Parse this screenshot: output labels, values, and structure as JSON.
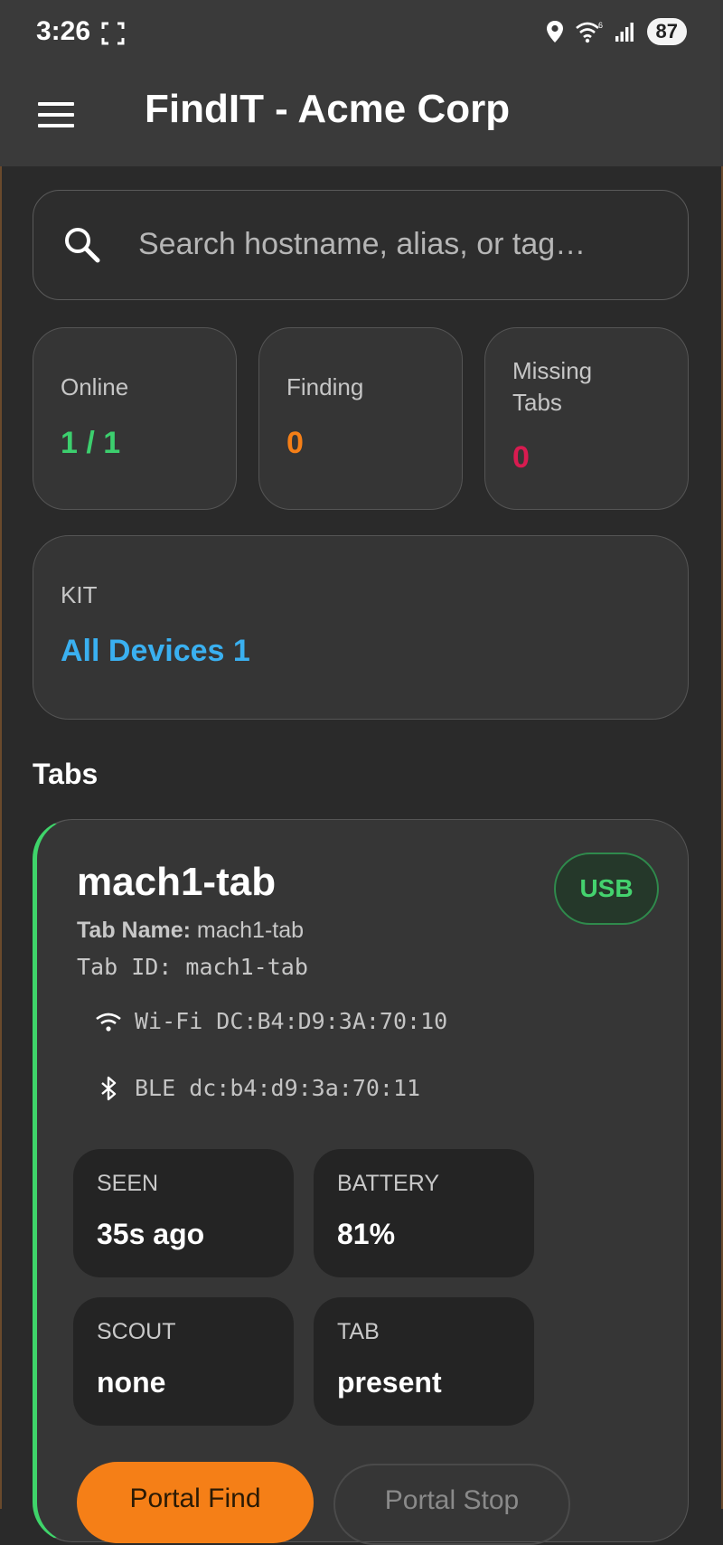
{
  "status_bar": {
    "time": "3:26",
    "battery": "87",
    "icons": [
      "screen-record-icon",
      "location-icon",
      "wifi-6-icon",
      "cell-signal-icon"
    ]
  },
  "app_bar": {
    "title": "FindIT - Acme Corp"
  },
  "search": {
    "placeholder": "Search hostname, alias, or tag…"
  },
  "stats": {
    "online": {
      "label": "Online",
      "value": "1 / 1",
      "color": "#3ccf6e"
    },
    "finding": {
      "label": "Finding",
      "value": "0",
      "color": "#f57f17"
    },
    "missing": {
      "label_line1": "Missing",
      "label_line2": "Tabs",
      "value": "0",
      "color": "#d81b50"
    }
  },
  "kit": {
    "label": "KIT",
    "value": "All Devices 1"
  },
  "section": {
    "tabs_title": "Tabs"
  },
  "tab": {
    "title": "mach1-tab",
    "badge": "USB",
    "tab_name_label": "Tab Name:",
    "tab_name_value": "mach1-tab",
    "tab_id_line": "Tab ID: mach1-tab",
    "wifi": "Wi-Fi DC:B4:D9:3A:70:10",
    "ble": "BLE dc:b4:d9:3a:70:11",
    "accent_color": "#3fd46a",
    "tiles": [
      {
        "label": "SEEN",
        "value": "35s ago"
      },
      {
        "label": "BATTERY",
        "value": "81%"
      },
      {
        "label": "SCOUT",
        "value": "none"
      },
      {
        "label": "TAB",
        "value": "present"
      }
    ],
    "actions": {
      "primary": "Portal Find",
      "secondary": "Portal Stop"
    }
  }
}
